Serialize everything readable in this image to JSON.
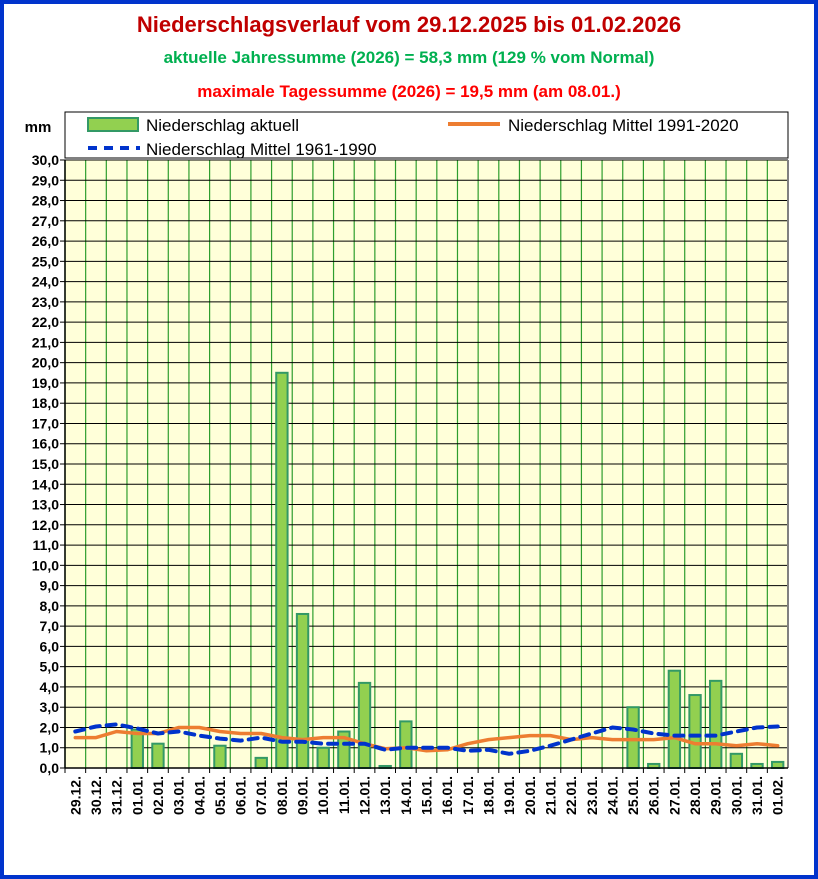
{
  "chart_data": {
    "type": "bar",
    "title": "Niederschlagsverlauf vom 29.12.2025 bis 01.02.2026",
    "subtitle1": "aktuelle Jahressumme (2026) = 58,3 mm (129 % vom Normal)",
    "subtitle2": "maximale Tagessumme (2026) = 19,5 mm (am 08.01.)",
    "ylabel": "mm",
    "ylim": [
      0,
      30
    ],
    "ytick_step": 1,
    "grid": true,
    "legend_placement": "top",
    "categories": [
      "29.12.",
      "30.12.",
      "31.12.",
      "01.01.",
      "02.01.",
      "03.01.",
      "04.01.",
      "05.01.",
      "06.01.",
      "07.01.",
      "08.01.",
      "09.01.",
      "10.01.",
      "11.01.",
      "12.01.",
      "13.01.",
      "14.01.",
      "15.01.",
      "16.01.",
      "17.01.",
      "18.01.",
      "19.01.",
      "20.01.",
      "21.01.",
      "22.01.",
      "23.01.",
      "24.01.",
      "25.01.",
      "26.01.",
      "27.01.",
      "28.01.",
      "29.01.",
      "30.01.",
      "31.01.",
      "01.02."
    ],
    "series": [
      {
        "name": "Niederschlag aktuell",
        "type": "bar",
        "color": "#92d050",
        "values": [
          0,
          0,
          0,
          1.9,
          1.2,
          0,
          0,
          1.1,
          0,
          0.5,
          19.5,
          7.6,
          1.0,
          1.8,
          4.2,
          0.1,
          2.3,
          0,
          0,
          0,
          0,
          0,
          0,
          0,
          0,
          0,
          0,
          3.0,
          0.2,
          4.8,
          3.6,
          4.3,
          0.7,
          0.2,
          0.3
        ]
      },
      {
        "name": "Niederschlag Mittel 1991-2020",
        "type": "line",
        "color": "#ed7d31",
        "values": [
          1.5,
          1.5,
          1.8,
          1.7,
          1.7,
          2.0,
          2.0,
          1.8,
          1.7,
          1.7,
          1.5,
          1.4,
          1.5,
          1.5,
          1.2,
          0.95,
          1.0,
          0.85,
          0.9,
          1.2,
          1.4,
          1.5,
          1.6,
          1.6,
          1.4,
          1.5,
          1.4,
          1.4,
          1.4,
          1.5,
          1.2,
          1.2,
          1.1,
          1.2,
          1.1
        ]
      },
      {
        "name": "Niederschlag Mittel 1961-1990",
        "type": "line-dashed",
        "color": "#0033cc",
        "values": [
          1.8,
          2.05,
          2.15,
          1.95,
          1.7,
          1.8,
          1.6,
          1.45,
          1.35,
          1.5,
          1.3,
          1.3,
          1.2,
          1.2,
          1.2,
          0.9,
          1.0,
          1.0,
          1.0,
          0.85,
          0.9,
          0.7,
          0.85,
          1.1,
          1.4,
          1.7,
          2.0,
          1.9,
          1.7,
          1.6,
          1.6,
          1.6,
          1.8,
          2.0,
          2.05
        ]
      }
    ]
  }
}
